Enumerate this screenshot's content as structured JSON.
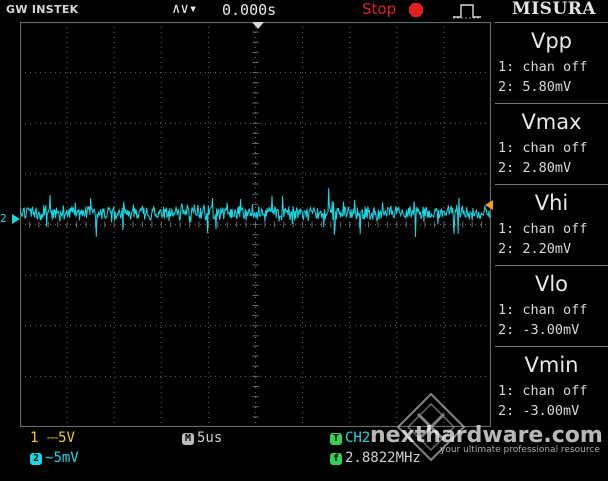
{
  "topbar": {
    "brand": "GW INSTEK",
    "trigger_icons": "∧∨▾",
    "trigger_time": "0.000s",
    "run_state": "Stop",
    "panel_title": "MISURA"
  },
  "measurements": [
    {
      "title": "Vpp",
      "line1": "1: chan off",
      "line2": "2: 5.80mV"
    },
    {
      "title": "Vmax",
      "line1": "1: chan off",
      "line2": "2: 2.80mV"
    },
    {
      "title": "Vhi",
      "line1": "1: chan off",
      "line2": "2: 2.20mV"
    },
    {
      "title": "Vlo",
      "line1": "1: chan off",
      "line2": "2: -3.00mV"
    },
    {
      "title": "Vmin",
      "line1": "1: chan off",
      "line2": "2: -3.00mV"
    }
  ],
  "bottom": {
    "ch1_num": "1",
    "ch1_coupling": "⎓",
    "ch1_scale": "5V",
    "ch2_num": "2",
    "ch2_coupling": "∼",
    "ch2_scale": "5mV",
    "timebase_badge": "M",
    "timebase": "5us",
    "trigger_badge": "T",
    "trigger_source": "CH2",
    "freq_badge": "f",
    "frequency": "2.8822MHz"
  },
  "watermark": {
    "site": "nexthardware.com",
    "tagline": "your ultimate professional resource"
  },
  "markers": {
    "ch2_label": "2"
  },
  "colors": {
    "ch1": "#f0d020",
    "ch2": "#17d9e6",
    "run_state": "#e22020",
    "grid": "#6a6a6a"
  }
}
